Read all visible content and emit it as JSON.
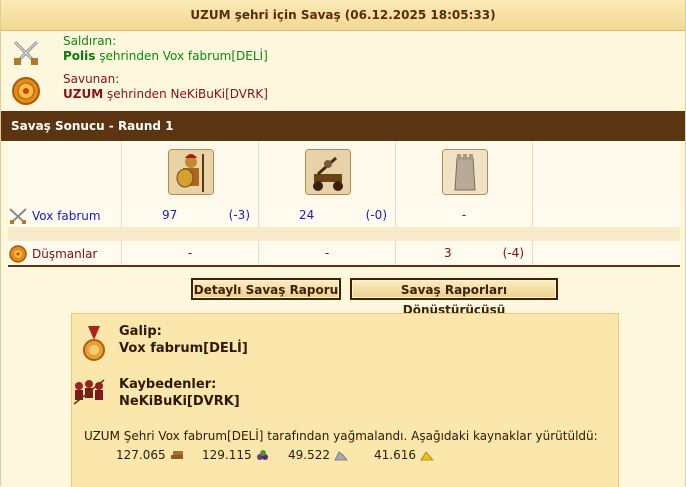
{
  "header": {
    "title": "UZUM şehri için Savaş (06.12.2025 18:05:33)"
  },
  "attacker": {
    "label": "Saldıran:",
    "city": "Polis",
    "line_rest": " şehrinden Vox fabrum[DELİ]"
  },
  "defender": {
    "label": "Savunan:",
    "city": "UZUM",
    "line_rest": " şehrinden NeKiBuKi[DVRK]"
  },
  "round": {
    "title": "Savaş Sonucu - Raund 1"
  },
  "table": {
    "units": [
      "hoplite-unit-icon",
      "catapult-unit-icon",
      "wall-icon"
    ],
    "rows": [
      {
        "name": "Vox fabrum",
        "icon": "crossed-swords-icon",
        "cells": [
          {
            "value": "97",
            "delta": "(-3)"
          },
          {
            "value": "24",
            "delta": "(-0)"
          },
          {
            "value": "-",
            "delta": ""
          }
        ]
      },
      {
        "name": "Düşmanlar",
        "icon": "shield-icon",
        "cells": [
          {
            "value": "-",
            "delta": ""
          },
          {
            "value": "-",
            "delta": ""
          },
          {
            "value": "3",
            "delta": "(-4)"
          }
        ]
      }
    ]
  },
  "buttons": {
    "detailed_report": "Detaylı Savaş Raporu",
    "converter": "Savaş Raporları Dönüştürücüsü"
  },
  "result": {
    "winner_label": "Galip:",
    "winner_name": "Vox fabrum[DELİ]",
    "losers_label": "Kaybedenler:",
    "losers_name": "NeKiBuKi[DVRK]",
    "plunder_text": "UZUM Şehri Vox fabrum[DELİ] tarafından yağmalandı. Aşağıdaki kaynaklar yürütüldü:",
    "resources": [
      {
        "amount": "127.065",
        "icon": "wood-icon"
      },
      {
        "amount": "129.115",
        "icon": "wine-icon"
      },
      {
        "amount": "49.522",
        "icon": "marble-icon"
      },
      {
        "amount": "41.616",
        "icon": "sulfur-icon"
      }
    ]
  },
  "colors": {
    "round_bar": "#5b3512",
    "attacker_text": "#0a8a0a",
    "defender_text": "#8b1010",
    "link_blue": "#1a1abf"
  }
}
